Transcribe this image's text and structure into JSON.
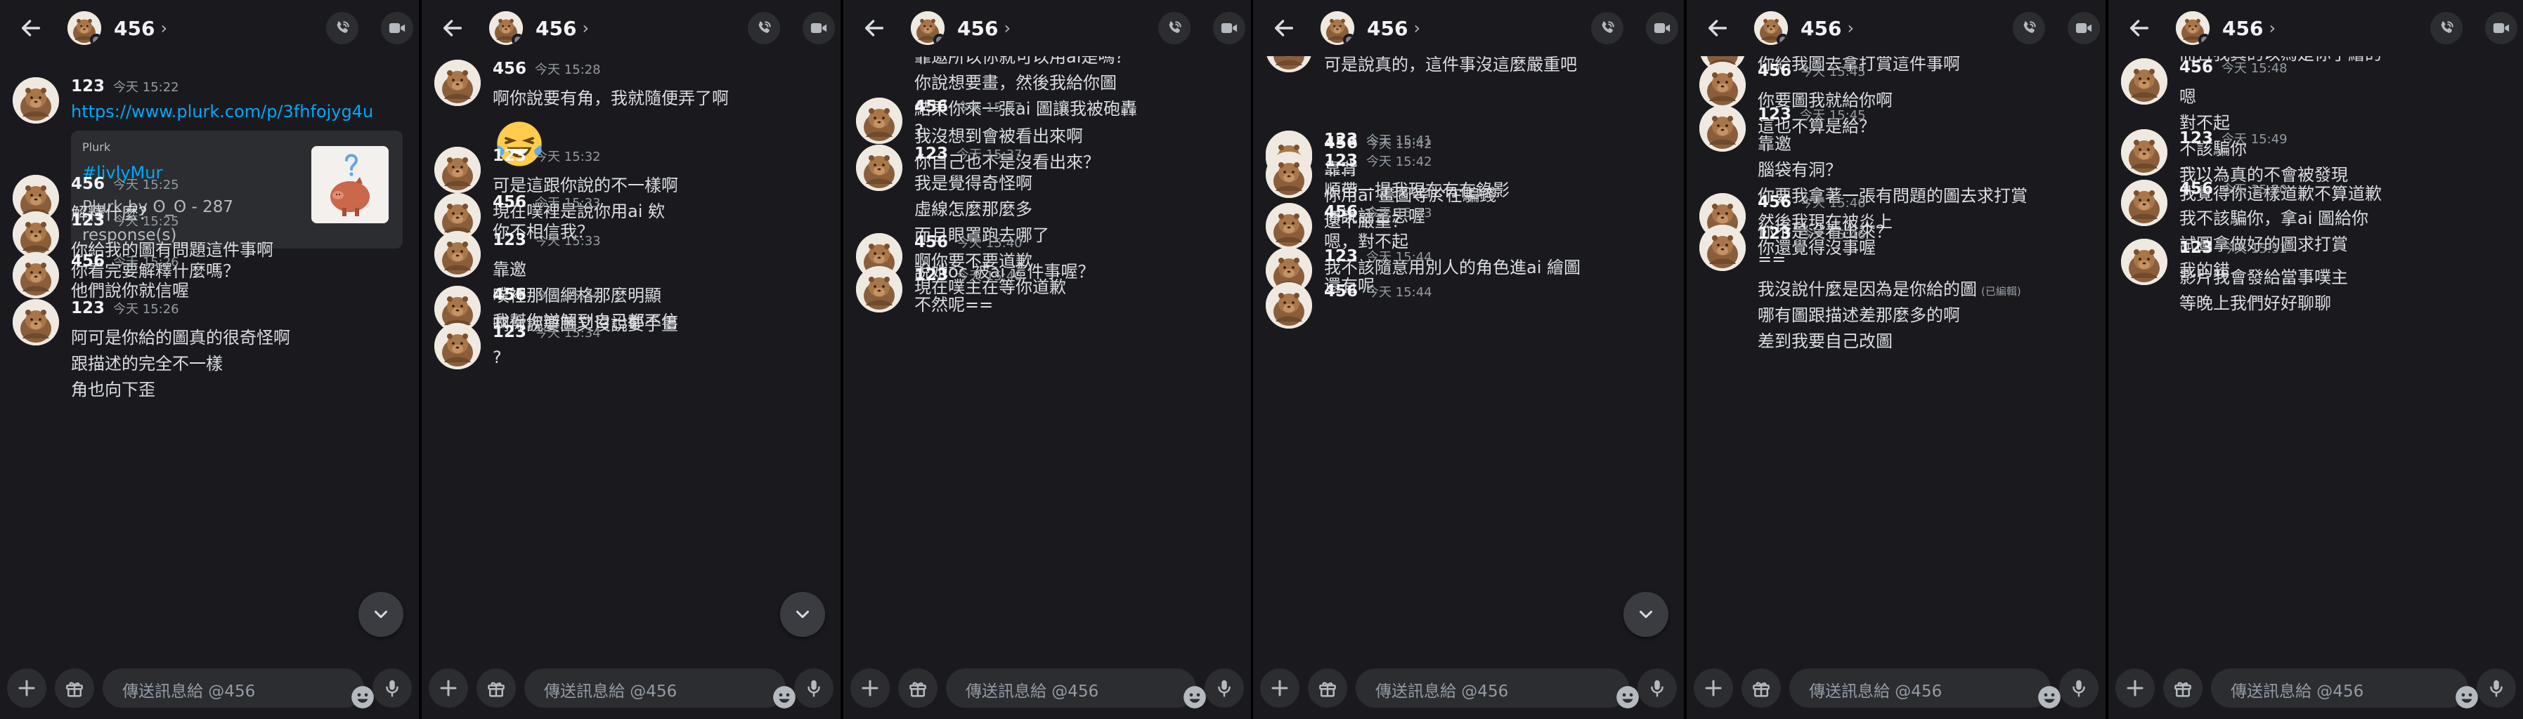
{
  "chat": {
    "username": "456",
    "chevron": "›",
    "composer_placeholder": "傳送訊息給 @456",
    "today": "今天"
  },
  "icons": {
    "back": "arrow-left-icon",
    "call": "phone-call-icon",
    "video": "video-camera-icon",
    "add": "plus-icon",
    "gift": "gift-icon",
    "emoji": "smiley-face-icon",
    "mic": "microphone-icon",
    "jump": "chevron-down-icon"
  },
  "colors": {
    "background": "#1a1a1e",
    "bubble": "#2b2d31",
    "link": "#00a8fc",
    "muted": "#949ba4",
    "text": "#dbdee1"
  },
  "panels": [
    {
      "messages": [
        {
          "author": "123",
          "time": "15:22",
          "lines": [],
          "link": "https://www.plurk.com/p/3fhfojyg4u",
          "embed": {
            "provider": "Plurk",
            "title": "#livlyMur",
            "description": "Plurk by ʘ_ʘ - 287 response(s)"
          },
          "after": [
            "你看完要解釋什麼嗎？"
          ]
        },
        {
          "author": "456",
          "time": "15:25",
          "lines": [
            "解釋什麼？"
          ]
        },
        {
          "author": "123",
          "time": "15:25",
          "lines": [
            "你給我的圖有問題這件事啊"
          ]
        },
        {
          "author": "456",
          "time": "15:26",
          "lines": [
            "他們說你就信喔"
          ]
        },
        {
          "author": "123",
          "time": "15:26",
          "lines": [
            "阿可是你給的圖真的很奇怪啊",
            "跟描述的完全不一樣",
            "角也向下歪"
          ]
        }
      ]
    },
    {
      "messages": [
        {
          "author": "456",
          "time": "15:28",
          "lines": [
            "啊你說要有角，我就隨便弄了啊"
          ],
          "emoji": "😂"
        },
        {
          "author": "123",
          "time": "15:32",
          "lines": [
            "可是這跟你說的不一樣啊",
            "現在噗裡是說你用ai 欸"
          ]
        },
        {
          "author": "456",
          "time": "15:33",
          "lines": [
            "你不相信我？"
          ]
        },
        {
          "author": "123",
          "time": "15:33",
          "lines": [
            "靠邀",
            "噗裡那個網格那麼明顯",
            "我幫你辯解到自己都不信"
          ]
        },
        {
          "author": "456",
          "time": "15:34",
          "lines": [
            "啊你說要圖又沒說要手畫"
          ]
        },
        {
          "author": "123",
          "time": "15:34",
          "lines": [
            "?"
          ]
        }
      ]
    },
    {
      "messages": [
        {
          "author": "",
          "time": "",
          "cont": true,
          "lines": [
            "?",
            "靠邀所以你就可以用ai是嗎？",
            "你說想要畫，然後我給你圖",
            "結果你來一張ai 圖讓我被砲轟",
            "?"
          ]
        },
        {
          "author": "456",
          "time": "15:37",
          "lines": [
            "我沒想到會被看出來啊",
            "你自己也不是沒看出來？"
          ]
        },
        {
          "author": "123",
          "time": "15:37",
          "lines": [
            "我是覺得奇怪啊",
            "虛線怎麼那麼多",
            "而且眼罩跑去哪了",
            "啊你要不要道歉",
            "現在噗主在等你道歉"
          ]
        },
        {
          "author": "456",
          "time": "15:40",
          "lines": [
            "說她oc 被ai 這件事喔？"
          ]
        },
        {
          "author": "123",
          "time": "15:40",
          "lines": [
            "不然呢=="
          ]
        }
      ]
    },
    {
      "messages": [
        {
          "author": "456",
          "time": "15:40",
          "lines": [
            "可是說真的，這件事沒這麼嚴重吧"
          ]
        },
        {
          "author": "123",
          "time": "15:41",
          "lines": [
            "靠背",
            "你用ai 畫圖等於在騙錢",
            "還不嚴重？"
          ]
        },
        {
          "author": "456",
          "time": "15:42",
          "lines": [
            "......"
          ]
        },
        {
          "author": "123",
          "time": "15:42",
          "lines": [
            "順帶一提我現在有在錄影",
            "你說話三思喔"
          ]
        },
        {
          "author": "456",
          "time": "15:43",
          "lines": [
            "嗯，對不起",
            "我不該隨意用別人的角色進ai 繪圖"
          ]
        },
        {
          "author": "123",
          "time": "15:44",
          "lines": [
            "還有呢"
          ]
        },
        {
          "author": "456",
          "time": "15:44",
          "lines": []
        }
      ]
    },
    {
      "messages": [
        {
          "author": "123",
          "time": "15:44",
          "lines": [
            "你給我圖去拿打賞這件事啊"
          ]
        },
        {
          "author": "456",
          "time": "15:45",
          "lines": [
            "你要圖我就給你啊",
            "這也不算是給？"
          ]
        },
        {
          "author": "123",
          "time": "15:45",
          "lines": [
            "靠邀",
            "腦袋有洞？",
            "你要我拿著一張有問題的圖去求打賞",
            "然後我現在被炎上",
            "你還覺得沒事喔"
          ]
        },
        {
          "author": "456",
          "time": "15:46",
          "lines": [
            "你不是沒看出來？"
          ]
        },
        {
          "author": "123",
          "time": "15:46",
          "lines": [
            "==",
            "我沒說什麼是因為是你給的圖",
            "哪有圖跟描述差那麼多的啊",
            "差到我要自己改圖"
          ],
          "edited_line": 1,
          "edited": "(已編輯)"
        }
      ]
    },
    {
      "messages": [
        {
          "author": "",
          "time": "",
          "cont": true,
          "lines": [
            "差到我要自己改圖",
            "而且我真的以為是你手繪的"
          ]
        },
        {
          "author": "456",
          "time": "15:48",
          "lines": [
            "嗯",
            "對不起",
            "不該騙你",
            "我以為真的不會被發現"
          ]
        },
        {
          "author": "123",
          "time": "15:49",
          "lines": [
            "......",
            "我覺得你這樣道歉不算道歉"
          ]
        },
        {
          "author": "456",
          "time": "15:50",
          "lines": [
            "我不該騙你，拿ai 圖給你",
            "試圖拿做好的圖求打賞",
            "我的錯"
          ]
        },
        {
          "author": "123",
          "time": "15:51",
          "lines": [
            "影片我會發給當事噗主",
            "等晚上我們好好聊聊"
          ]
        }
      ]
    }
  ]
}
